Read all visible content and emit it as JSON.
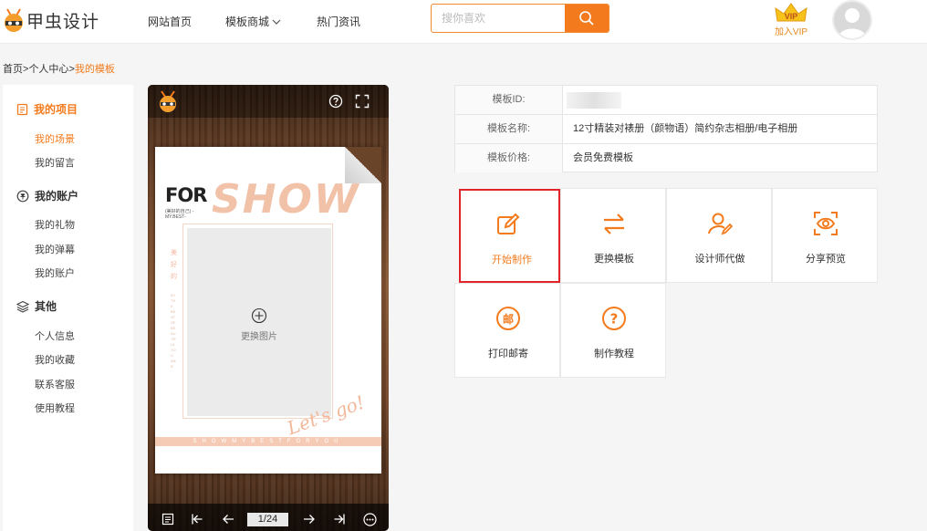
{
  "header": {
    "brand": "甲虫设计",
    "nav": [
      {
        "label": "网站首页"
      },
      {
        "label": "模板商城"
      },
      {
        "label": "热门资讯"
      }
    ],
    "search_placeholder": "搜你喜欢",
    "vip_badge": "VIP",
    "vip_label": "加入VIP"
  },
  "breadcrumb": {
    "home": "首页",
    "sep1": ">",
    "center": "个人中心",
    "sep2": ">",
    "current": "我的模板"
  },
  "sidebar": {
    "sections": [
      {
        "title": "我的项目",
        "items": [
          "我的场景",
          "我的留言"
        ]
      },
      {
        "title": "我的账户",
        "items": [
          "我的礼物",
          "我的弹幕",
          "我的账户"
        ]
      },
      {
        "title": "其他",
        "items": [
          "个人信息",
          "我的收藏",
          "联系客服",
          "使用教程"
        ]
      }
    ]
  },
  "preview": {
    "page_indicator": "1/24",
    "replace_image_label": "更换图片",
    "page_for": "FOR",
    "page_for_sub": "(美好的自己) -MY.BEST-",
    "page_show": "SHOW",
    "page_vertical": "美好的",
    "page_vertical_small": "BY THE BEST OF BEAUTIFUL YOU AND",
    "page_lets": "Let's go!",
    "page_band": "SHOWMYBESTFORYOU"
  },
  "info": {
    "rows": [
      {
        "label": "模板ID:",
        "value": ""
      },
      {
        "label": "模板名称:",
        "value": "12寸精装对裱册（颜物语）简约杂志相册/电子相册"
      },
      {
        "label": "模板价格:",
        "value": "会员免费模板"
      }
    ]
  },
  "actions": [
    {
      "label": "开始制作",
      "icon": "edit-icon"
    },
    {
      "label": "更换模板",
      "icon": "swap-icon"
    },
    {
      "label": "设计师代做",
      "icon": "designer-icon"
    },
    {
      "label": "分享预览",
      "icon": "scan-eye-icon"
    },
    {
      "label": "打印邮寄",
      "icon": "mail-icon",
      "glyph": "邮"
    },
    {
      "label": "制作教程",
      "icon": "help-icon",
      "glyph": "?"
    }
  ],
  "colors": {
    "accent": "#f37b1d",
    "highlight_border": "#e2232b"
  }
}
